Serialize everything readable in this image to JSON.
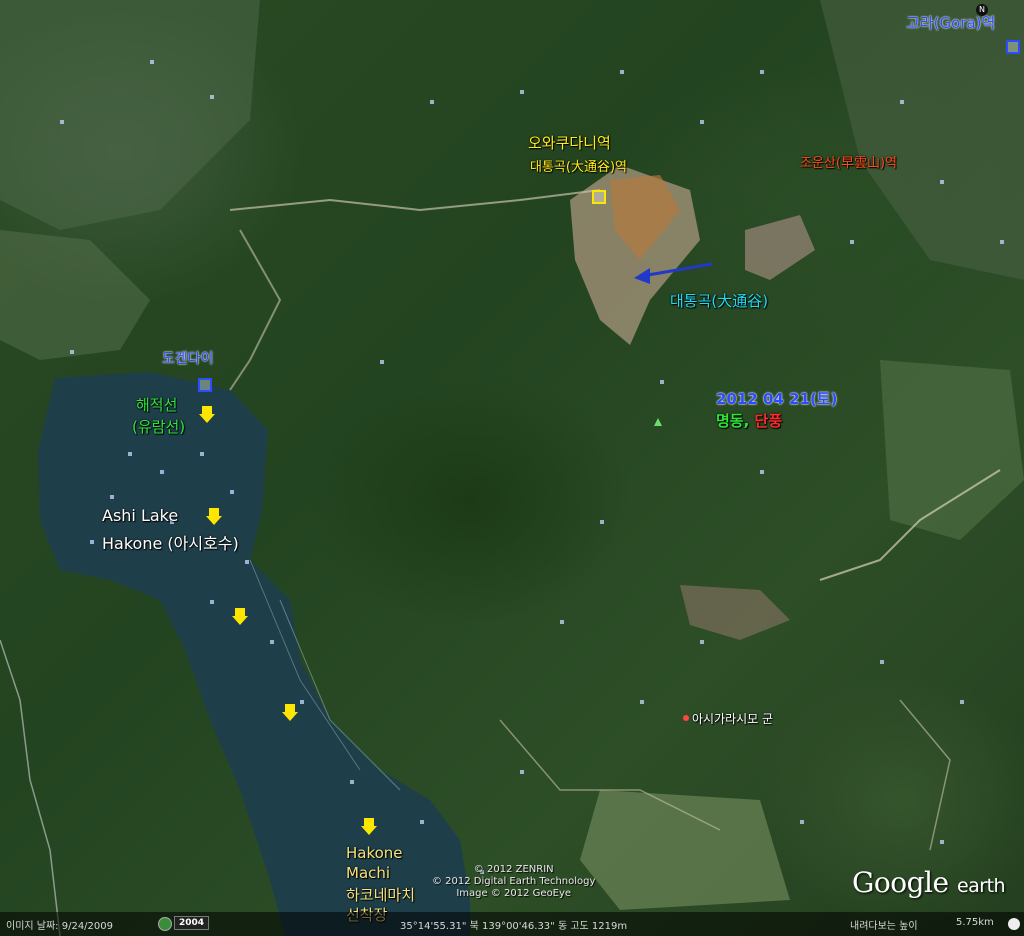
{
  "labels": {
    "gora_station": "고라(Gora)역",
    "owakudani_station_kr": "오와쿠다니역",
    "owakudani_station_kanji": "대통곡(大通谷)역",
    "soun_station": "조운산(早雲山)역",
    "owakudani_valley": "대통곡(大通谷)",
    "togendai": "도겐다이",
    "date_line1": "2012 04 21(토)",
    "date_line2_a": "명동, ",
    "date_line2_b": "단풍",
    "pirate_ship_1": "해적선",
    "pirate_ship_2": "(유람선)",
    "ashi_lake_1": "Ashi Lake",
    "ashi_lake_2": "Hakone (아시호수)",
    "hakone_machi_1": "Hakone",
    "hakone_machi_2": "Machi",
    "hakone_machi_3": "하코네마치",
    "hakone_machi_4": "선착장",
    "ashigara": "아시가라시모 군"
  },
  "attribution": {
    "line1": "© 2012 ZENRIN",
    "line2": "© 2012 Digital Earth Technology",
    "line3": "Image © 2012 GeoEye",
    "logo_main": "Google",
    "logo_sub": "earth"
  },
  "statusbar": {
    "imagery_date": "이미지 날짜: 9/24/2009",
    "year": "2004",
    "coords": "35°14'55.31\" 북 139°00'46.33\" 동 고도 1219m",
    "eye_alt_label": "내려다보는 높이",
    "eye_alt": "5.75km"
  },
  "colors": {
    "lake": "#1e3f4a",
    "forest": "#2a4a24",
    "label_yellow": "#ffeb1a",
    "label_blue": "#2a4dff",
    "label_green": "#2fe33a",
    "label_cyan": "#22d9f2",
    "label_red": "#ff2a2a"
  }
}
